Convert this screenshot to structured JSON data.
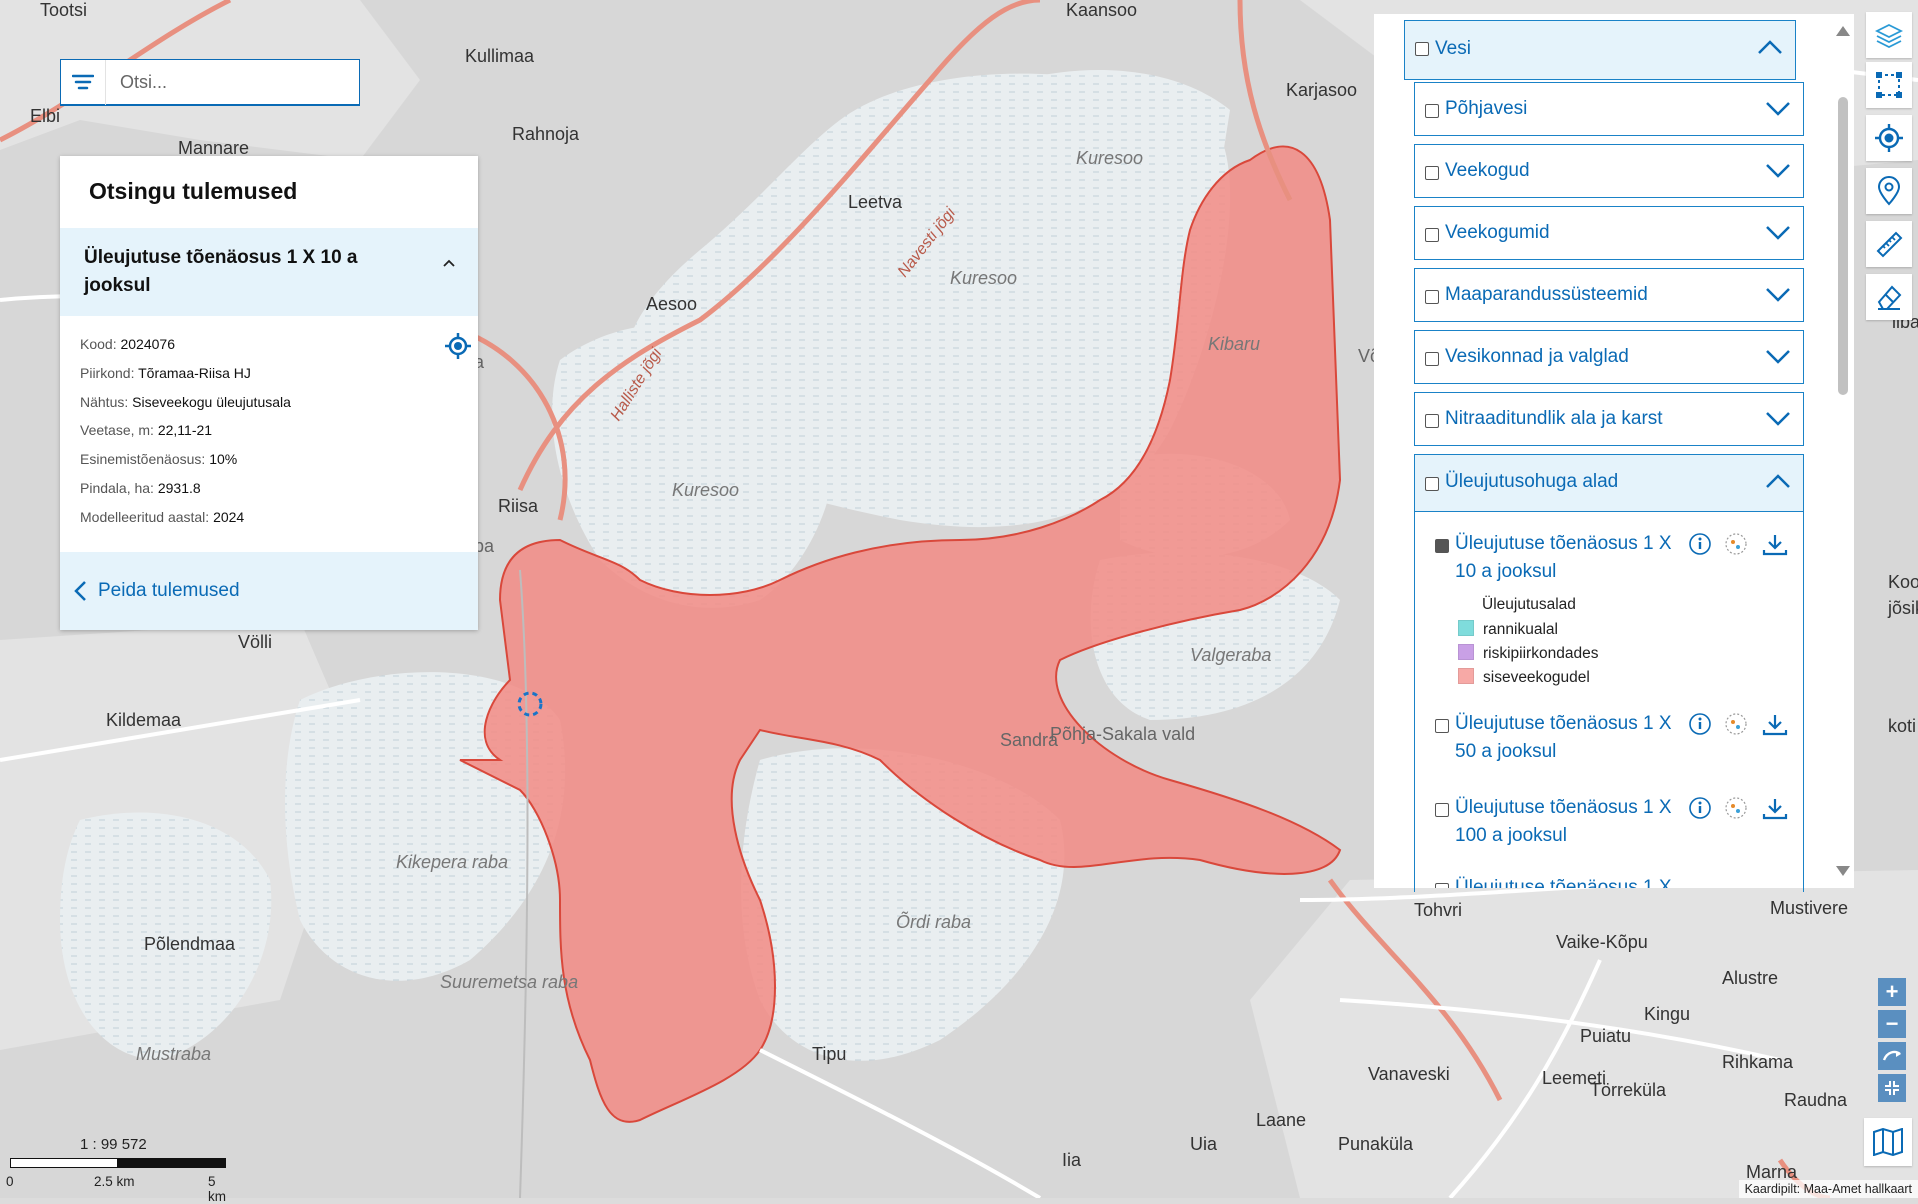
{
  "search": {
    "placeholder": "Otsi..."
  },
  "results": {
    "title": "Otsingu tulemused",
    "item_title": "Üleujutuse tõenäosus 1 X 10 a jooksul",
    "fields": [
      {
        "label": "Kood:",
        "value": "2024076"
      },
      {
        "label": "Piirkond:",
        "value": "Tõramaa-Riisa HJ"
      },
      {
        "label": "Nähtus:",
        "value": "Siseveekogu üleujutusala"
      },
      {
        "label": "Veetase, m:",
        "value": "22,11-21"
      },
      {
        "label": "Esinemistõenäosus:",
        "value": "10%"
      },
      {
        "label": "Pindala, ha:",
        "value": "2931.8"
      },
      {
        "label": "Modelleeritud aastal:",
        "value": "2024"
      }
    ],
    "hide_label": "Peida tulemused"
  },
  "layers": {
    "group": "Vesi",
    "subgroups": [
      "Põhjavesi",
      "Veekogud",
      "Veekogumid",
      "Maaparandussüsteemid",
      "Vesikonnad ja valglad",
      "Nitraaditundlik ala ja karst",
      "Üleujutusohuga alad"
    ],
    "flood_layers": [
      {
        "name": "Üleujutuse tõenäosus 1 X 10 a jooksul",
        "checked": true
      },
      {
        "name": "Üleujutuse tõenäosus 1 X 50 a jooksul",
        "checked": false
      },
      {
        "name": "Üleujutuse tõenäosus 1 X 100 a jooksul",
        "checked": false
      },
      {
        "name": "Üleujutuse tõenäosus 1 X",
        "checked": false
      }
    ],
    "legend": {
      "title": "Üleujutusalad",
      "items": [
        {
          "label": "rannikualal",
          "color": "#7fdcdc"
        },
        {
          "label": "riskipiirkondades",
          "color": "#c9a0e6"
        },
        {
          "label": "siseveekogudel",
          "color": "#f7a9a6"
        }
      ]
    }
  },
  "map": {
    "places": [
      "Tootsi",
      "Kullimaa",
      "Rahnoja",
      "Elbi",
      "Mannare",
      "Karjasoo",
      "Kaansoo",
      "Kuresoo",
      "Leetva",
      "Navesti jõgi",
      "Kuresoo",
      "Aesoo",
      "Halliste jõgi",
      "nera",
      "Kibaru",
      "Võ",
      "Riisa",
      "Kuresoo",
      "Valgeraba",
      "Völli",
      "Kildemaa",
      "Sandra",
      "Põhja-Sakala vald",
      "Kikepera raba",
      "Õrdi raba",
      "Tohvri",
      "Mustivere",
      "Vaike-Kõpu",
      "Alustre",
      "Kingu",
      "Puiatu",
      "Rihkama",
      "Põlendmaa",
      "Suuremetsa raba",
      "Mustraba",
      "Tipu",
      "Leemeti",
      "Vanaveski",
      "Törreküla",
      "Raudna",
      "Laane",
      "Uia",
      "Punaküla",
      "Iia",
      "Marna",
      "Kookla",
      "jõsiku",
      "koti",
      "iiba",
      "ba"
    ],
    "scale_text": "1 : 99 572",
    "scale_ticks": [
      "0",
      "2.5 km",
      "5 km"
    ],
    "attribution": "Kaardipilt: Maa-Amet hallkaart",
    "colors": {
      "flood": "#f28b85",
      "flood_edge": "#d9483b",
      "bog": "#e9eef0",
      "land": "#d6d6d6",
      "accent": "#0a6ab5"
    }
  },
  "toolbar": [
    "layers-icon",
    "select-area-icon",
    "locate-icon",
    "pin-icon",
    "ruler-icon",
    "eraser-icon"
  ],
  "zoom": [
    "+",
    "−"
  ]
}
